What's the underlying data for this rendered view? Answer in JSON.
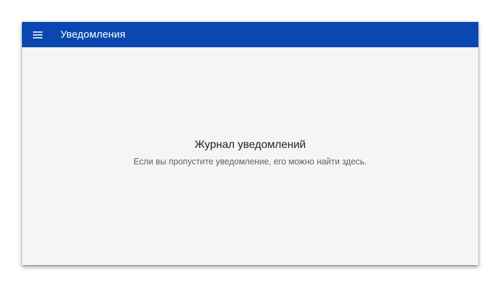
{
  "theme": {
    "appbar_color": "#0a47b0",
    "background_color": "#f5f5f5"
  },
  "appbar": {
    "title": "Уведомления",
    "menu_icon": "hamburger-menu-icon"
  },
  "empty_state": {
    "title": "Журнал уведомлений",
    "subtitle": "Если вы пропустите уведомление, его можно найти здесь."
  }
}
